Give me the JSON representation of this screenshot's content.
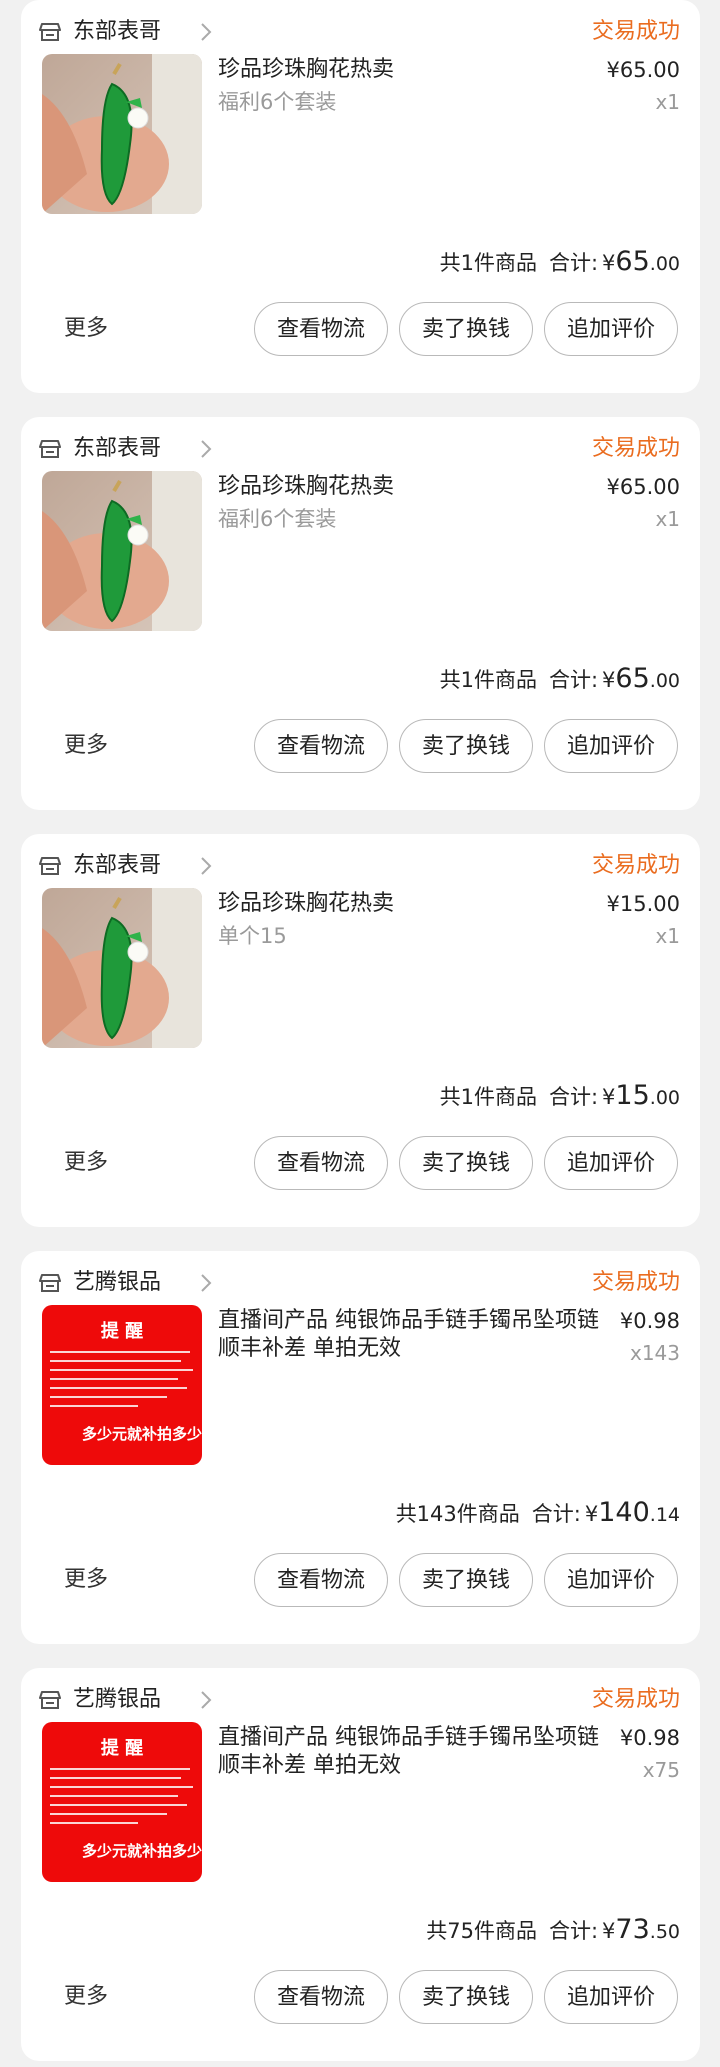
{
  "orders": [
    {
      "shop_name": "东部表哥",
      "status": "交易成功",
      "item_title": "珍品珍珠胸花热卖",
      "variant": "福利6个套装",
      "price": "¥65.00",
      "qty": "x1",
      "count_text": "共1件商品",
      "total_label": "合计:",
      "total_symbol": "¥",
      "total_int": "65",
      "total_dec": ".00",
      "more": "更多",
      "btn_logistics": "查看物流",
      "btn_resell": "卖了换钱",
      "btn_review": "追加评价",
      "image": "pearl-brooch-photo"
    },
    {
      "shop_name": "东部表哥",
      "status": "交易成功",
      "item_title": "珍品珍珠胸花热卖",
      "variant": "福利6个套装",
      "price": "¥65.00",
      "qty": "x1",
      "count_text": "共1件商品",
      "total_label": "合计:",
      "total_symbol": "¥",
      "total_int": "65",
      "total_dec": ".00",
      "more": "更多",
      "btn_logistics": "查看物流",
      "btn_resell": "卖了换钱",
      "btn_review": "追加评价",
      "image": "pearl-brooch-photo"
    },
    {
      "shop_name": "东部表哥",
      "status": "交易成功",
      "item_title": "珍品珍珠胸花热卖",
      "variant": "单个15",
      "price": "¥15.00",
      "qty": "x1",
      "count_text": "共1件商品",
      "total_label": "合计:",
      "total_symbol": "¥",
      "total_int": "15",
      "total_dec": ".00",
      "more": "更多",
      "btn_logistics": "查看物流",
      "btn_resell": "卖了换钱",
      "btn_review": "追加评价",
      "image": "pearl-brooch-photo"
    },
    {
      "shop_name": "艺腾银品",
      "status": "交易成功",
      "item_title": "直播间产品 纯银饰品手链手镯吊坠项链 顺丰补差 单拍无效",
      "variant": "",
      "price": "¥0.98",
      "qty": "x143",
      "count_text": "共143件商品",
      "total_label": "合计:",
      "total_symbol": "¥",
      "total_int": "140",
      "total_dec": ".14",
      "more": "更多",
      "btn_logistics": "查看物流",
      "btn_resell": "卖了换钱",
      "btn_review": "追加评价",
      "image": "red-notice-image",
      "notice_heading": "提 醒",
      "notice_footer": "多少元就补拍多少"
    },
    {
      "shop_name": "艺腾银品",
      "status": "交易成功",
      "item_title": "直播间产品 纯银饰品手链手镯吊坠项链 顺丰补差 单拍无效",
      "variant": "",
      "price": "¥0.98",
      "qty": "x75",
      "count_text": "共75件商品",
      "total_label": "合计:",
      "total_symbol": "¥",
      "total_int": "73",
      "total_dec": ".50",
      "more": "更多",
      "btn_logistics": "查看物流",
      "btn_resell": "卖了换钱",
      "btn_review": "追加评价",
      "image": "red-notice-image",
      "notice_heading": "提 醒",
      "notice_footer": "多少元就补拍多少"
    }
  ],
  "colors": {
    "status": "#ea6c1f",
    "notice_red": "#ee0a0a",
    "brooch_green": "#1f9a3a"
  }
}
